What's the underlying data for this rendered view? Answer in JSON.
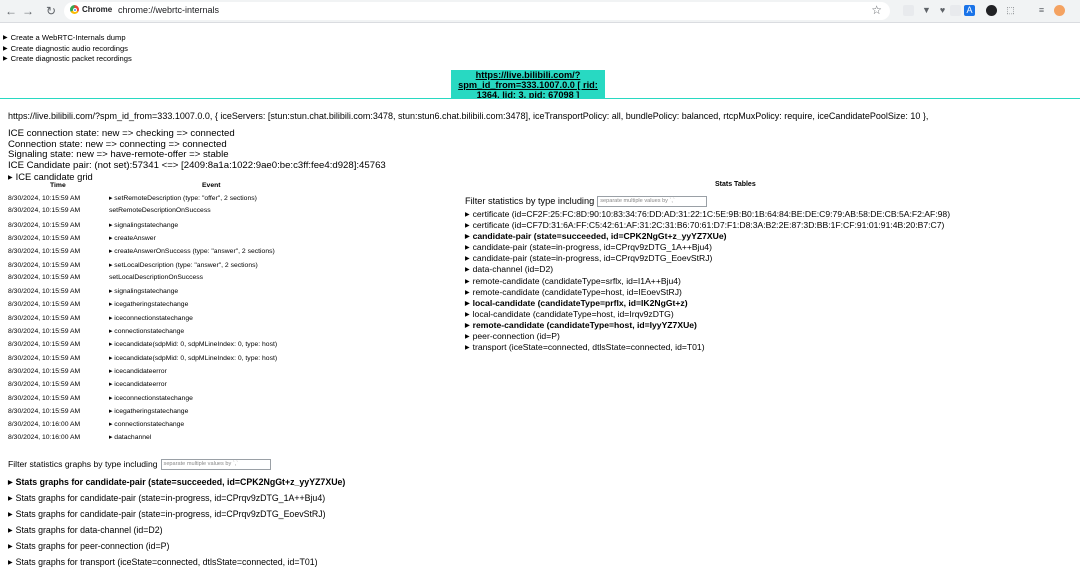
{
  "browser": {
    "chip_label": "Chrome",
    "url": "chrome://webrtc-internals"
  },
  "top_links": [
    "Create a WebRTC-Internals dump",
    "Create diagnostic audio recordings",
    "Create diagnostic packet recordings"
  ],
  "tab": {
    "label": "https://live.bilibili.com/?spm_id_from=333.1007.0.0 [ rid: 1364, lid: 3, pid: 67098 ]"
  },
  "peer_connection": {
    "config_line": "https://live.bilibili.com/?spm_id_from=333.1007.0.0, { iceServers: [stun:stun.chat.bilibili.com:3478, stun:stun6.chat.bilibili.com:3478], iceTransportPolicy: all, bundlePolicy: balanced, rtcpMuxPolicy: require, iceCandidatePoolSize: 10 },",
    "states": [
      "ICE connection state: new => checking => connected",
      "Connection state: new => connecting => connected",
      "Signaling state: new => have-remote-offer => stable",
      "ICE Candidate pair: (not set):57341 <=> [2409:8a1a:1022:9ae0:be:c3ff:fee4:d928]:45763"
    ],
    "ice_grid_label": "ICE candidate grid"
  },
  "events": {
    "headers": {
      "time": "Time",
      "event": "Event"
    },
    "rows": [
      {
        "time": "8/30/2024, 10:15:59 AM",
        "event": "▸ setRemoteDescription (type: \"offer\", 2 sections)"
      },
      {
        "time": "8/30/2024, 10:15:59 AM",
        "event": "setRemoteDescriptionOnSuccess"
      },
      {
        "time": "8/30/2024, 10:15:59 AM",
        "event": "▸ signalingstatechange"
      },
      {
        "time": "8/30/2024, 10:15:59 AM",
        "event": "▸ createAnswer"
      },
      {
        "time": "8/30/2024, 10:15:59 AM",
        "event": "▸ createAnswerOnSuccess (type: \"answer\", 2 sections)"
      },
      {
        "time": "8/30/2024, 10:15:59 AM",
        "event": "▸ setLocalDescription (type: \"answer\", 2 sections)"
      },
      {
        "time": "8/30/2024, 10:15:59 AM",
        "event": "setLocalDescriptionOnSuccess"
      },
      {
        "time": "8/30/2024, 10:15:59 AM",
        "event": "▸ signalingstatechange"
      },
      {
        "time": "8/30/2024, 10:15:59 AM",
        "event": "▸ icegatheringstatechange"
      },
      {
        "time": "8/30/2024, 10:15:59 AM",
        "event": "▸ iceconnectionstatechange"
      },
      {
        "time": "8/30/2024, 10:15:59 AM",
        "event": "▸ connectionstatechange"
      },
      {
        "time": "8/30/2024, 10:15:59 AM",
        "event": "▸ icecandidate(sdpMid: 0, sdpMLineIndex: 0, type: host)"
      },
      {
        "time": "8/30/2024, 10:15:59 AM",
        "event": "▸ icecandidate(sdpMid: 0, sdpMLineIndex: 0, type: host)"
      },
      {
        "time": "8/30/2024, 10:15:59 AM",
        "event": "▸ icecandidateerror"
      },
      {
        "time": "8/30/2024, 10:15:59 AM",
        "event": "▸ icecandidateerror"
      },
      {
        "time": "8/30/2024, 10:15:59 AM",
        "event": "▸ iceconnectionstatechange"
      },
      {
        "time": "8/30/2024, 10:15:59 AM",
        "event": "▸ icegatheringstatechange"
      },
      {
        "time": "8/30/2024, 10:16:00 AM",
        "event": "▸ connectionstatechange"
      },
      {
        "time": "8/30/2024, 10:16:00 AM",
        "event": "▸ datachannel"
      }
    ]
  },
  "graphs_filter": {
    "label": "Filter statistics graphs by type including",
    "placeholder": "separate multiple values by `,`"
  },
  "graphs": [
    {
      "label": "Stats graphs for candidate-pair (state=succeeded, id=CPK2NgGt+z_yyYZ7XUe)",
      "bold": true
    },
    {
      "label": "Stats graphs for candidate-pair (state=in-progress, id=CPrqv9zDTG_1A++Bju4)",
      "bold": false
    },
    {
      "label": "Stats graphs for candidate-pair (state=in-progress, id=CPrqv9zDTG_EoevStRJ)",
      "bold": false
    },
    {
      "label": "Stats graphs for data-channel (id=D2)",
      "bold": false
    },
    {
      "label": "Stats graphs for peer-connection (id=P)",
      "bold": false
    },
    {
      "label": "Stats graphs for transport (iceState=connected, dtlsState=connected, id=T01)",
      "bold": false
    }
  ],
  "stats": {
    "title": "Stats Tables",
    "filter_label": "Filter statistics by type including",
    "placeholder": "separate multiple values by `,`",
    "items": [
      {
        "label": "certificate (id=CF2F:25:FC:8D:90:10:83:34:76:DD:AD:31:22:1C:5E:9B:B0:1B:64:84:BE:DE:C9:79:AB:58:DE:CB:5A:F2:AF:98)",
        "bold": false
      },
      {
        "label": "certificate (id=CF7D:31:6A:FF:C5:42:61:AF:31:2C:31:B6:70:61:D7:F1:D8:3A:B2:2E:87:3D:BB:1F:CF:91:01:91:4B:20:B7:C7)",
        "bold": false
      },
      {
        "label": "candidate-pair (state=succeeded, id=CPK2NgGt+z_yyYZ7XUe)",
        "bold": true
      },
      {
        "label": "candidate-pair (state=in-progress, id=CPrqv9zDTG_1A++Bju4)",
        "bold": false
      },
      {
        "label": "candidate-pair (state=in-progress, id=CPrqv9zDTG_EoevStRJ)",
        "bold": false
      },
      {
        "label": "data-channel (id=D2)",
        "bold": false
      },
      {
        "label": "remote-candidate (candidateType=srflx, id=I1A++Bju4)",
        "bold": false
      },
      {
        "label": "remote-candidate (candidateType=host, id=IEoevStRJ)",
        "bold": false
      },
      {
        "label": "local-candidate (candidateType=prflx, id=IK2NgGt+z)",
        "bold": true
      },
      {
        "label": "local-candidate (candidateType=host, id=Irqv9zDTG)",
        "bold": false
      },
      {
        "label": "remote-candidate (candidateType=host, id=IyyYZ7XUe)",
        "bold": true
      },
      {
        "label": "peer-connection (id=P)",
        "bold": false
      },
      {
        "label": "transport (iceState=connected, dtlsState=connected, id=T01)",
        "bold": false
      }
    ]
  }
}
